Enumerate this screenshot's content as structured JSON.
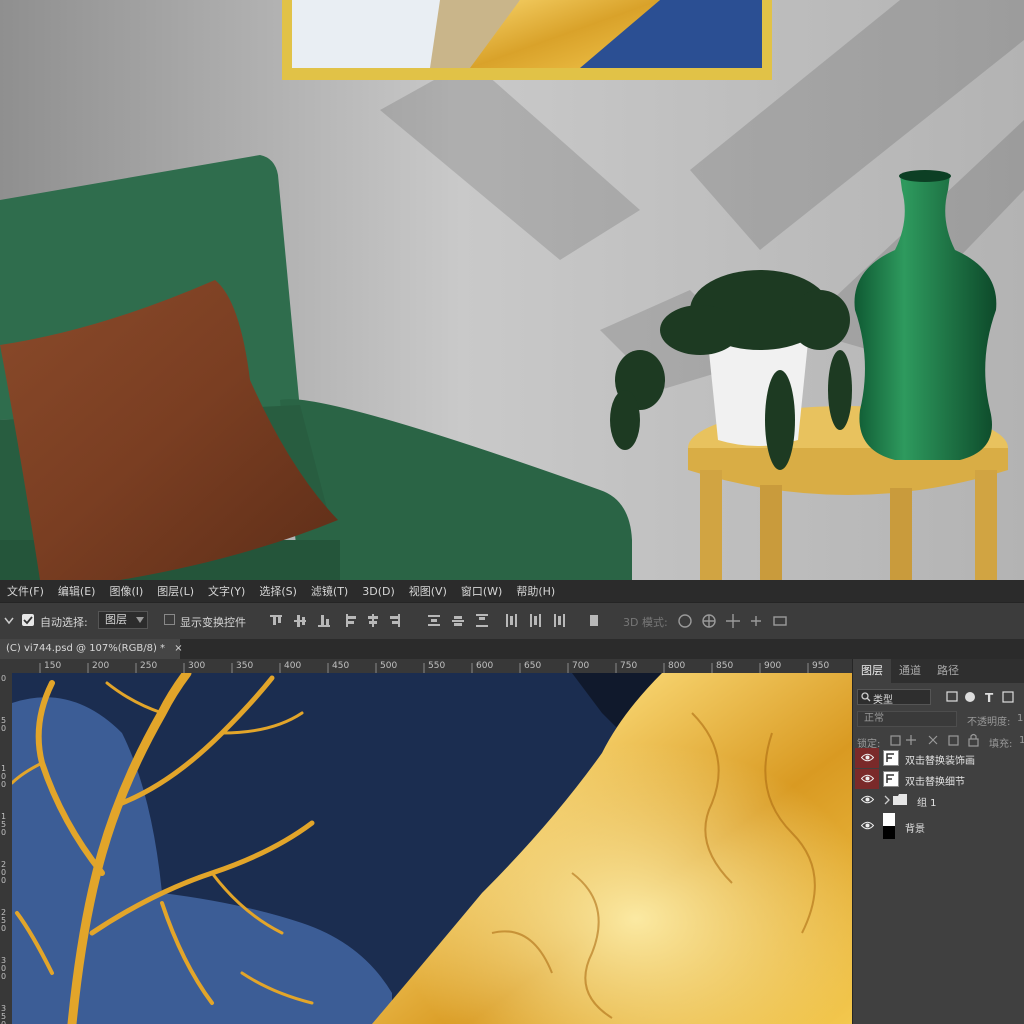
{
  "menu": [
    "文件(F)",
    "编辑(E)",
    "图像(I)",
    "图层(L)",
    "文字(Y)",
    "选择(S)",
    "滤镜(T)",
    "3D(D)",
    "视图(V)",
    "窗口(W)",
    "帮助(H)"
  ],
  "options": {
    "auto_select_label": "自动选择:",
    "auto_select_target": "图层",
    "show_transform_label": "显示变换控件",
    "mode_3d_label": "3D 模式:"
  },
  "document_tab": {
    "title": "(C) vi744.psd @ 107%(RGB/8) *",
    "close": "×"
  },
  "ruler": {
    "top": [
      "150",
      "200",
      "250",
      "300",
      "350",
      "400",
      "450",
      "500",
      "550",
      "600",
      "650",
      "700",
      "750",
      "800",
      "850",
      "900",
      "950"
    ],
    "left": [
      "0",
      "50",
      "100",
      "150",
      "200",
      "250",
      "300",
      "350"
    ]
  },
  "layers_panel": {
    "tabs": [
      "图层",
      "通道",
      "路径"
    ],
    "filter_type": "类型",
    "blend_mode": "正常",
    "opacity_label": "不透明度:",
    "opacity_value": "1",
    "lock_label": "锁定:",
    "fill_label": "填充:",
    "fill_value": "1",
    "layers": [
      {
        "name": "双击替换装饰画",
        "visible": true,
        "selected": true,
        "kind": "smart-object"
      },
      {
        "name": "双击替换细节",
        "visible": true,
        "selected": true,
        "kind": "smart-object"
      },
      {
        "name": "组 1",
        "visible": true,
        "selected": false,
        "kind": "group"
      },
      {
        "name": "背景",
        "visible": true,
        "selected": false,
        "kind": "background"
      }
    ]
  },
  "colors": {
    "highlight_row": "#7a2a2a",
    "panel_bg": "#404040",
    "bar_bg": "#2b2b2b"
  }
}
